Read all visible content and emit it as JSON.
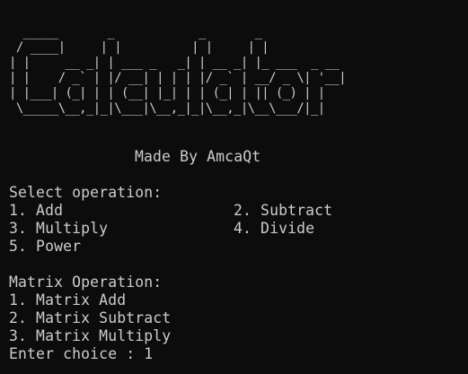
{
  "banner": {
    "ascii_art": "  _____       _            _       _\n / ____|     | |          | |     | |\n| |     __ _| | ___ _   _| | __ _| |_ ___  _ __\n| |    / _` | |/ __| | | | |/ _` | __/ _ \\| '__|\n| |___| (_| | | (__| |_| | | (_| | || (_) | |\n \\_____\\__,_|_|\\___|\\__,_|_|\\__,_|\\__\\___/|_|",
    "made_by": "Made By AmcaQt"
  },
  "menu": {
    "select_heading": "Select operation:",
    "operations": [
      {
        "label": "1. Add",
        "pair": "2. Subtract"
      },
      {
        "label": "3. Multiply",
        "pair": "4. Divide"
      },
      {
        "label": "5. Power",
        "pair": ""
      }
    ],
    "matrix_heading": "Matrix Operation:",
    "matrix_operations": [
      "1. Matrix Add",
      "2. Matrix Subtract",
      "3. Matrix Multiply"
    ],
    "prompt": "Enter choice : 1"
  },
  "colors": {
    "background": "#0c0c0c",
    "foreground": "#cccccc"
  }
}
